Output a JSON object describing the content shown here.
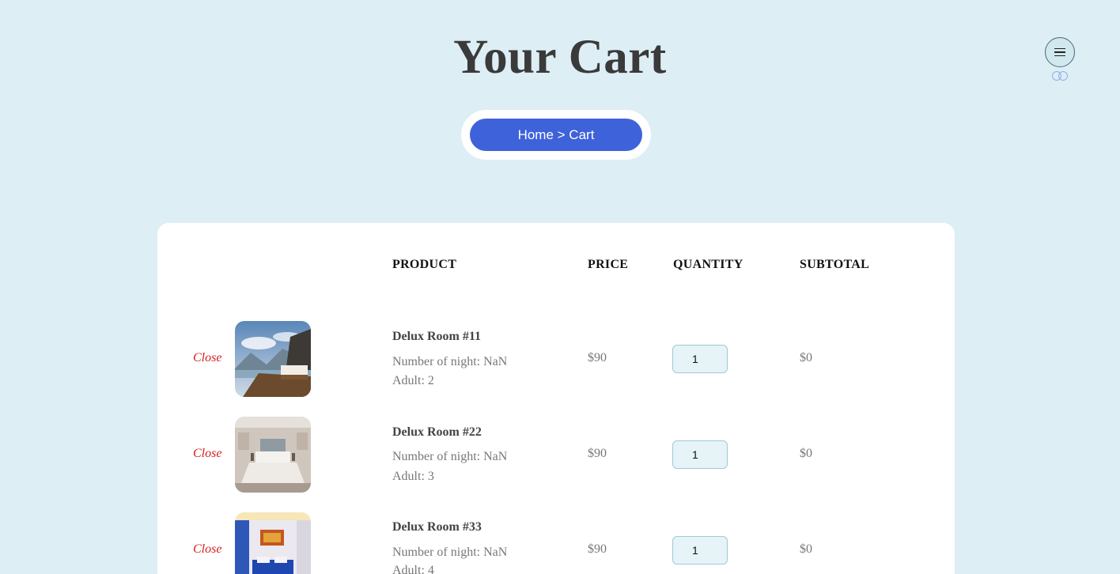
{
  "page": {
    "title": "Your Cart"
  },
  "header": {
    "menu_icon": "hamburger-icon",
    "toggle_icon": "theme-toggle-icon"
  },
  "breadcrumb": {
    "text": "Home > Cart"
  },
  "table": {
    "headers": [
      "PRODUCT",
      "PRICE",
      "QUANTITY",
      "SUBTOTAL"
    ],
    "rows": [
      {
        "close": "Close",
        "name": "Delux Room #11",
        "nights": "Number of night: NaN",
        "adults": "Adult: 2",
        "price": "$90",
        "quantity": "1",
        "subtotal": "$0"
      },
      {
        "close": "Close",
        "name": "Delux Room #22",
        "nights": "Number of night: NaN",
        "adults": "Adult: 3",
        "price": "$90",
        "quantity": "1",
        "subtotal": "$0"
      },
      {
        "close": "Close",
        "name": "Delux Room #33",
        "nights": "Number of night: NaN",
        "adults": "Adult: 4",
        "price": "$90",
        "quantity": "1",
        "subtotal": "$0"
      }
    ]
  },
  "colors": {
    "background": "#ddeef5",
    "accent": "#3e62d9",
    "close": "#d42020"
  }
}
